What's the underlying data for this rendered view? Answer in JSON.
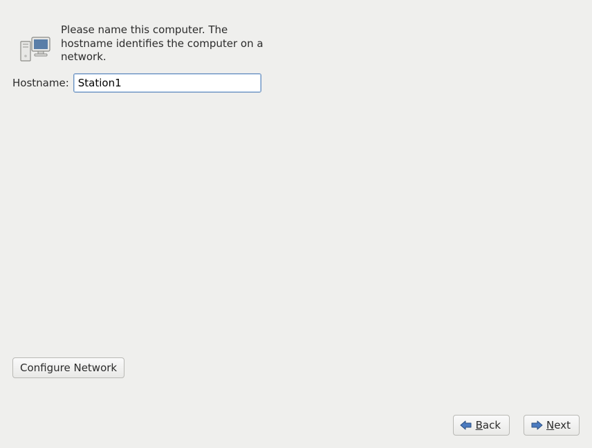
{
  "instruction_text": "Please name this computer.  The hostname identifies the computer on a network.",
  "hostname": {
    "label": "Hostname:",
    "value": "Station1"
  },
  "buttons": {
    "configure_network": "Configure Network",
    "back": {
      "mnemonic": "B",
      "rest": "ack"
    },
    "next": {
      "mnemonic": "N",
      "rest": "ext"
    }
  },
  "icon_names": {
    "header": "network-computer-icon",
    "back_arrow": "arrow-left-icon",
    "next_arrow": "arrow-right-icon"
  },
  "colors": {
    "background": "#efefed",
    "input_border": "#6f93c0",
    "arrow_fill": "#4a7abf",
    "arrow_stroke": "#2b4f82"
  }
}
